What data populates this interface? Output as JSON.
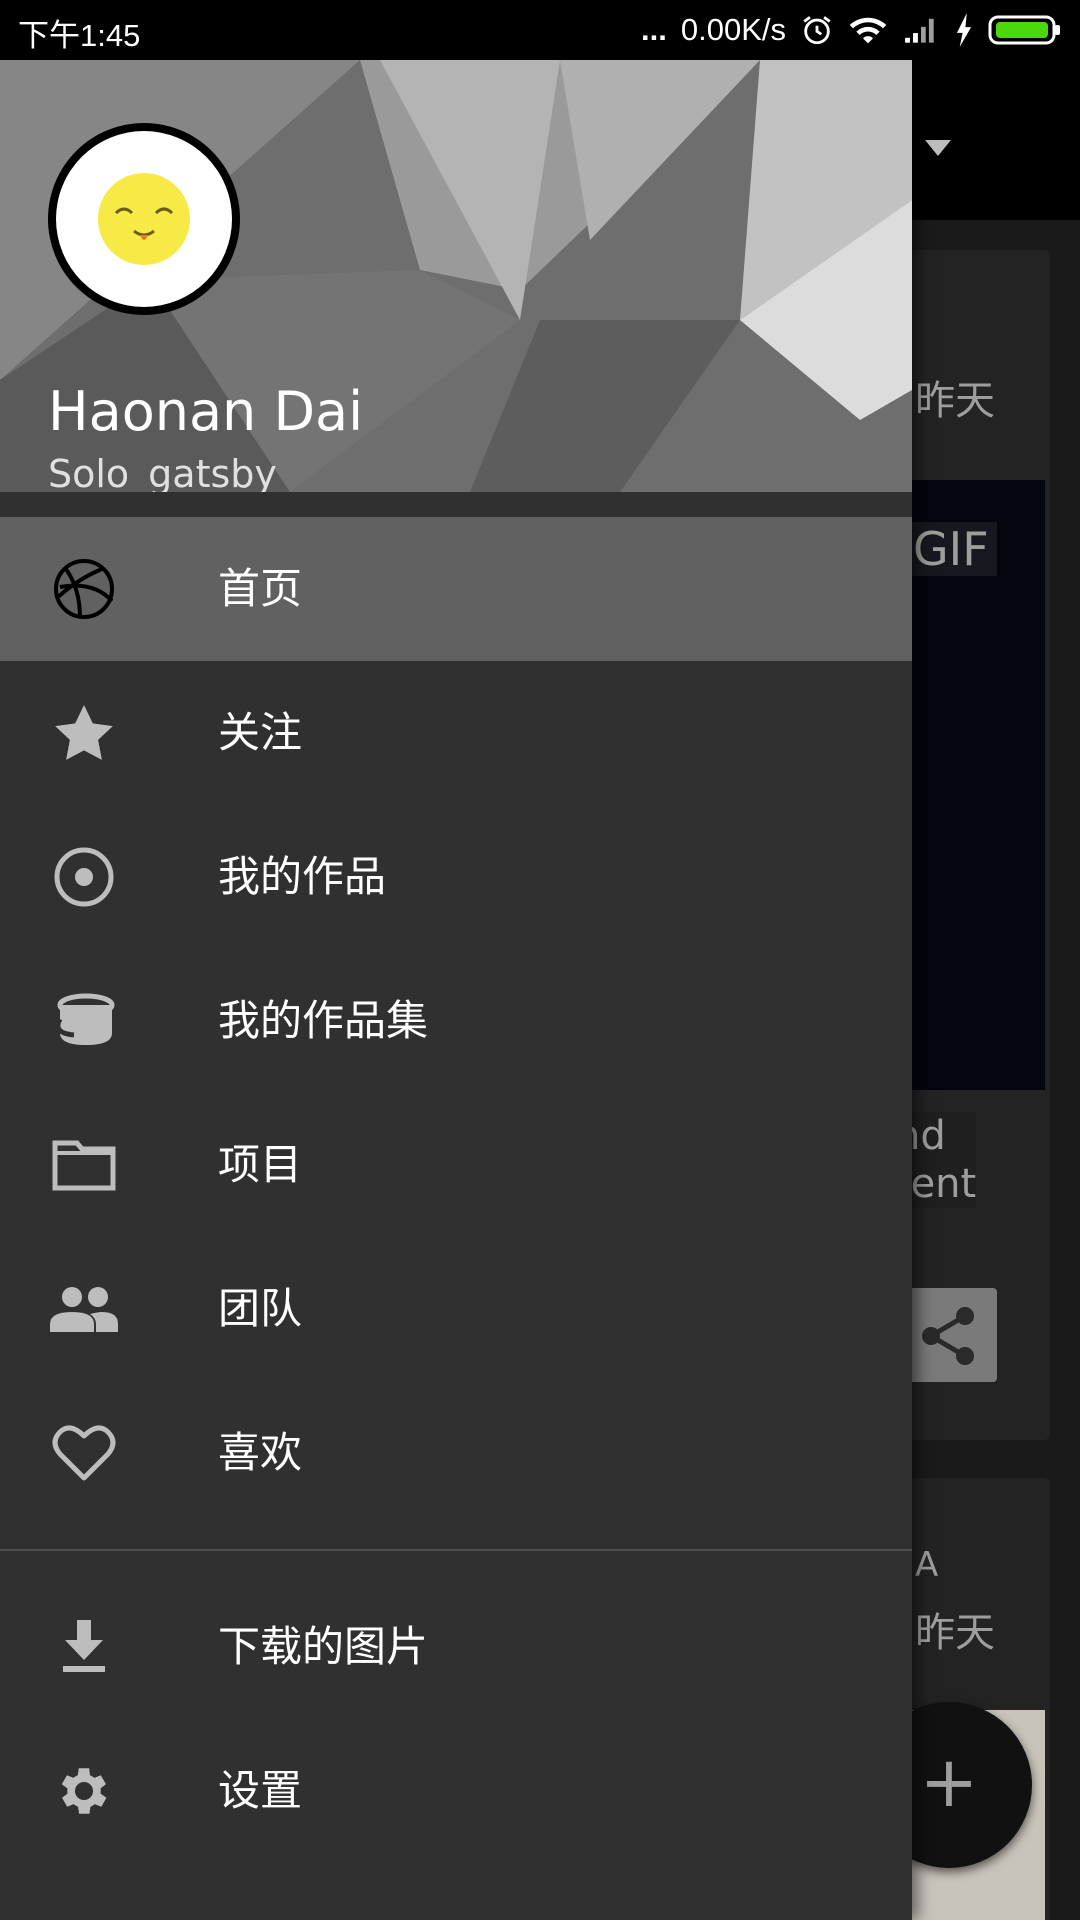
{
  "status_bar": {
    "time": "下午1:45",
    "net_speed": "0.00K/s",
    "dots": "..."
  },
  "background": {
    "toolbar_caret_icon": "caret-down-icon",
    "card1": {
      "meta_partial": "昨天",
      "gif_badge": "GIF",
      "desc_line1": "nd",
      "desc_line2": "rent"
    },
    "card2": {
      "meta_partial": "昨天",
      "meta_char": "A"
    },
    "fab_label": "+"
  },
  "drawer": {
    "user": {
      "name": "Haonan Dai",
      "username": "Solo_gatsby"
    },
    "primary_items": [
      {
        "label": "首页",
        "icon": "dribbble-ball-icon",
        "active": true
      },
      {
        "label": "关注",
        "icon": "star-icon"
      },
      {
        "label": "我的作品",
        "icon": "radio-target-icon"
      },
      {
        "label": "我的作品集",
        "icon": "bucket-icon"
      },
      {
        "label": "项目",
        "icon": "folder-icon"
      },
      {
        "label": "团队",
        "icon": "people-icon"
      },
      {
        "label": "喜欢",
        "icon": "heart-icon"
      }
    ],
    "secondary_items": [
      {
        "label": "下载的图片",
        "icon": "download-icon"
      },
      {
        "label": "设置",
        "icon": "settings-gear-icon"
      }
    ]
  },
  "colors": {
    "drawer_bg": "#303030",
    "active_item_bg": "#616161",
    "status_bar_bg": "#000000",
    "battery_green": "#4cd80f"
  }
}
